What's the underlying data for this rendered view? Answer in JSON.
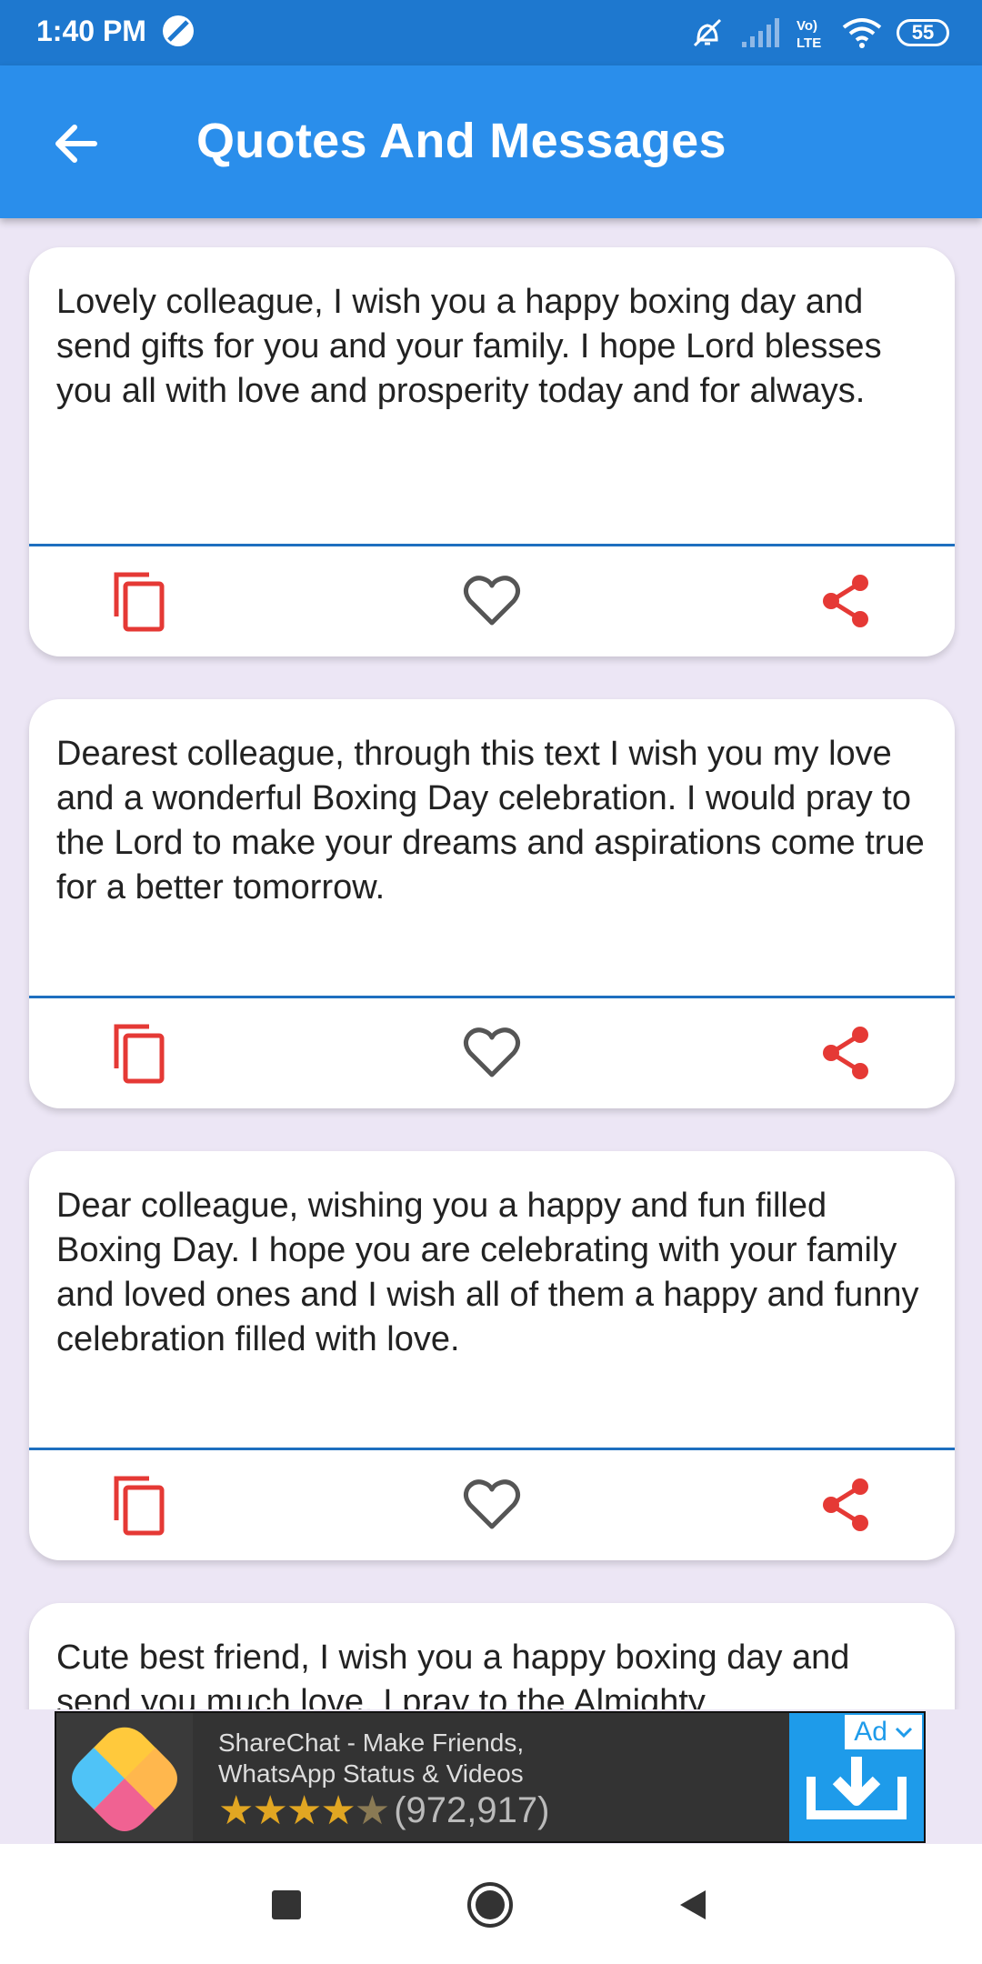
{
  "status_bar": {
    "time": "1:40 PM",
    "battery": "55",
    "icons": [
      "app-notification-icon",
      "vibrate-icon",
      "signal-icon",
      "volte-icon",
      "wifi-icon",
      "battery-icon"
    ]
  },
  "app_bar": {
    "title": "Quotes And Messages",
    "back_icon": "arrow-back-icon",
    "color": "#2A8EEB"
  },
  "messages": [
    {
      "text": "Lovely colleague, I wish you a happy boxing day and send gifts for you and your family. I hope Lord blesses you all with love and prosperity today and for always."
    },
    {
      "text": "Dearest colleague, through this text I wish you my love and a wonderful Boxing Day celebration. I would pray to the Lord to make your dreams and aspirations come true for a better tomorrow."
    },
    {
      "text": "Dear colleague, wishing you a happy and fun filled Boxing Day. I hope you are celebrating with your family and loved ones and I wish all of them a happy and funny celebration filled with love."
    },
    {
      "text": "Cute best friend, I wish you a happy boxing day and send you much love. I pray to the Almighty"
    }
  ],
  "card_actions": {
    "copy_icon": "copy-icon",
    "like_icon": "heart-icon",
    "share_icon": "share-icon",
    "accent_color": "#E53935"
  },
  "ad": {
    "title": "ShareChat - Make Friends, WhatsApp Status & Videos",
    "stars": "★★★★",
    "half_star": "★",
    "rating_count": "(972,917)",
    "badge": "Ad",
    "rating_value": 4.5,
    "cta_icon": "download-icon"
  },
  "nav_bar": {
    "icons": [
      "recents-icon",
      "home-icon",
      "back-icon"
    ]
  }
}
